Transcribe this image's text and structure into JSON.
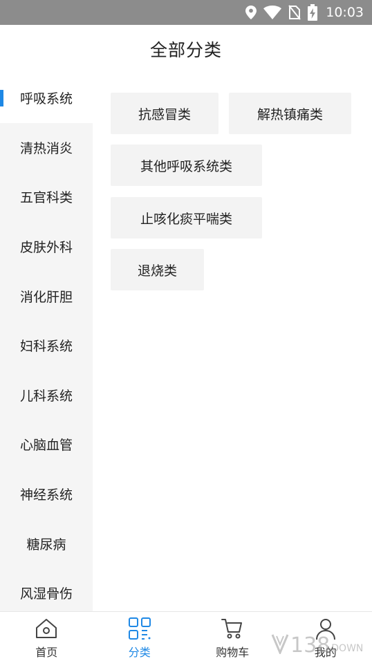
{
  "status_bar": {
    "time": "10:03",
    "icons": [
      "location-icon",
      "wifi-icon",
      "no-sim-icon",
      "battery-charging-icon"
    ]
  },
  "header": {
    "title": "全部分类"
  },
  "sidebar": {
    "active_index": 0,
    "items": [
      {
        "label": "呼吸系统"
      },
      {
        "label": "清热消炎"
      },
      {
        "label": "五官科类"
      },
      {
        "label": "皮肤外科"
      },
      {
        "label": "消化肝胆"
      },
      {
        "label": "妇科系统"
      },
      {
        "label": "儿科系统"
      },
      {
        "label": "心脑血管"
      },
      {
        "label": "神经系统"
      },
      {
        "label": "糖尿病"
      },
      {
        "label": "风湿骨伤"
      }
    ]
  },
  "subcategories": [
    {
      "label": "抗感冒类"
    },
    {
      "label": "解热镇痛类"
    },
    {
      "label": "其他呼吸系统类"
    },
    {
      "label": "止咳化痰平喘类"
    },
    {
      "label": "退烧类"
    }
  ],
  "bottom_nav": {
    "active_index": 1,
    "items": [
      {
        "label": "首页",
        "icon": "home-icon"
      },
      {
        "label": "分类",
        "icon": "category-grid-icon"
      },
      {
        "label": "购物车",
        "icon": "cart-icon"
      },
      {
        "label": "我的",
        "icon": "user-icon"
      }
    ]
  },
  "watermark": {
    "number": "138",
    "text": "DOWN"
  },
  "colors": {
    "accent": "#1e88e5",
    "status_bar": "#8c8c8c",
    "sidebar_bg": "#f5f5f5",
    "chip_bg": "#f3f3f3"
  }
}
